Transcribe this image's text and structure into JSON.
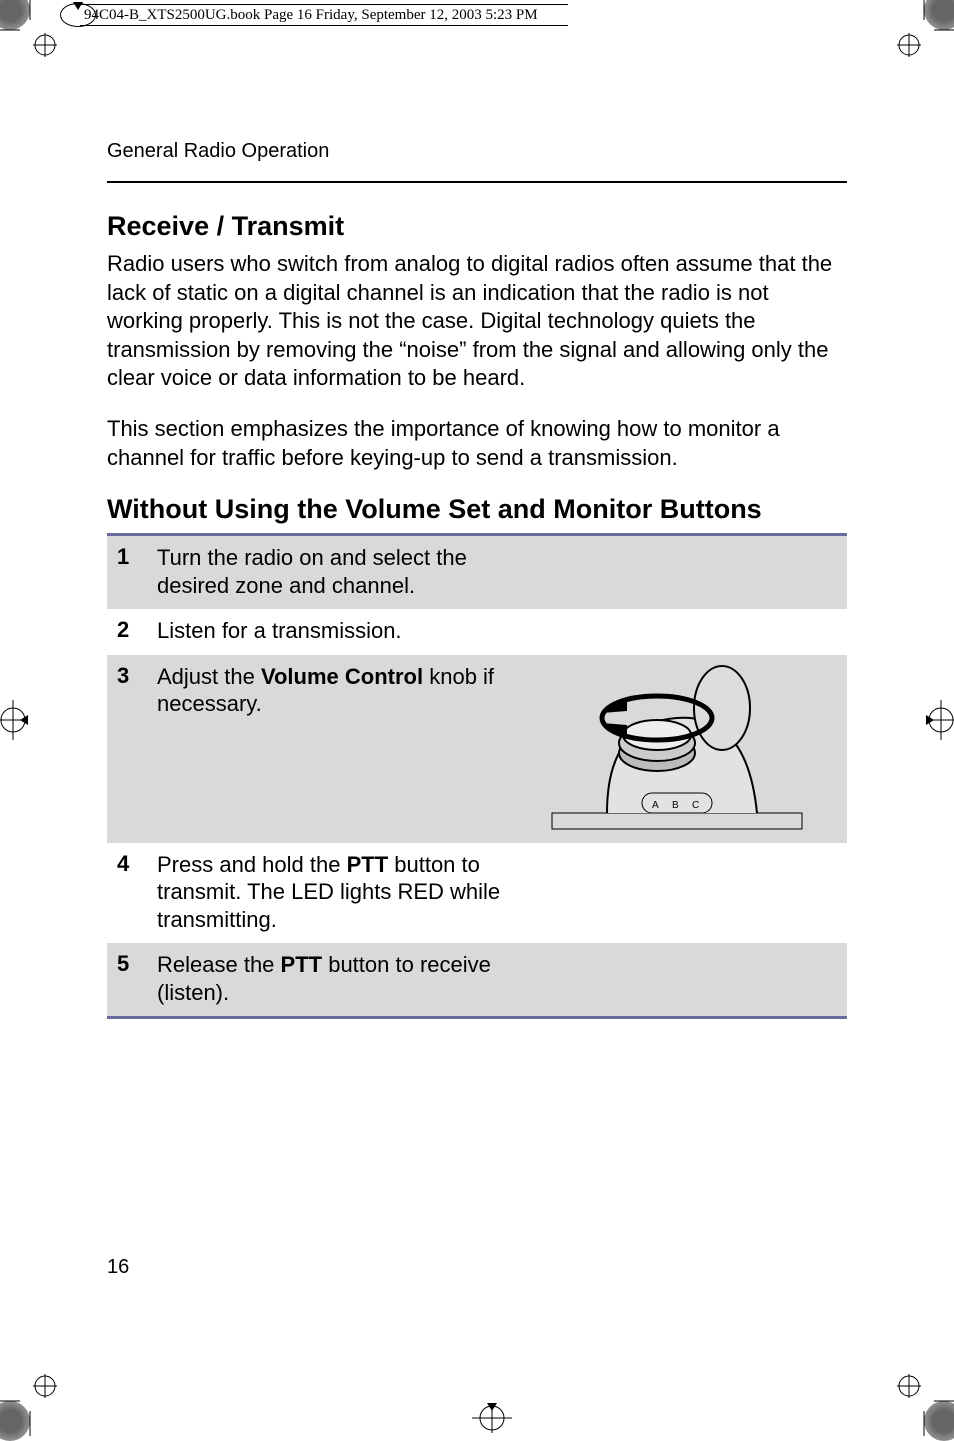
{
  "print": {
    "header_text": "94C04-B_XTS2500UG.book  Page 16  Friday, September 12, 2003  5:23 PM"
  },
  "running_head": "General Radio Operation",
  "section1": {
    "title": "Receive / Transmit",
    "p1": "Radio users who switch from analog to digital radios often assume that the lack of static on a digital channel is an indication that the radio is not working properly. This is not the case. Digital technology quiets the transmission by removing the “noise” from the signal and allowing only the clear voice or data information to be heard.",
    "p2": "This section emphasizes the importance of knowing how to monitor a channel for traffic before keying-up to send a transmission."
  },
  "section2": {
    "title": "Without Using the Volume Set and Monitor Buttons",
    "steps": [
      {
        "num": "1",
        "text_before": "Turn the radio on and select the desired zone and channel.",
        "bold": "",
        "text_after": ""
      },
      {
        "num": "2",
        "text_before": "Listen for a transmission.",
        "bold": "",
        "text_after": ""
      },
      {
        "num": "3",
        "text_before": "Adjust the ",
        "bold": "Volume Control",
        "text_after": " knob if necessary."
      },
      {
        "num": "4",
        "text_before": "Press and hold the ",
        "bold": "PTT",
        "text_after": " button to transmit. The LED lights RED while transmitting."
      },
      {
        "num": "5",
        "text_before": "Release the ",
        "bold": "PTT",
        "text_after": " button to receive (listen)."
      }
    ]
  },
  "page_number": "16"
}
